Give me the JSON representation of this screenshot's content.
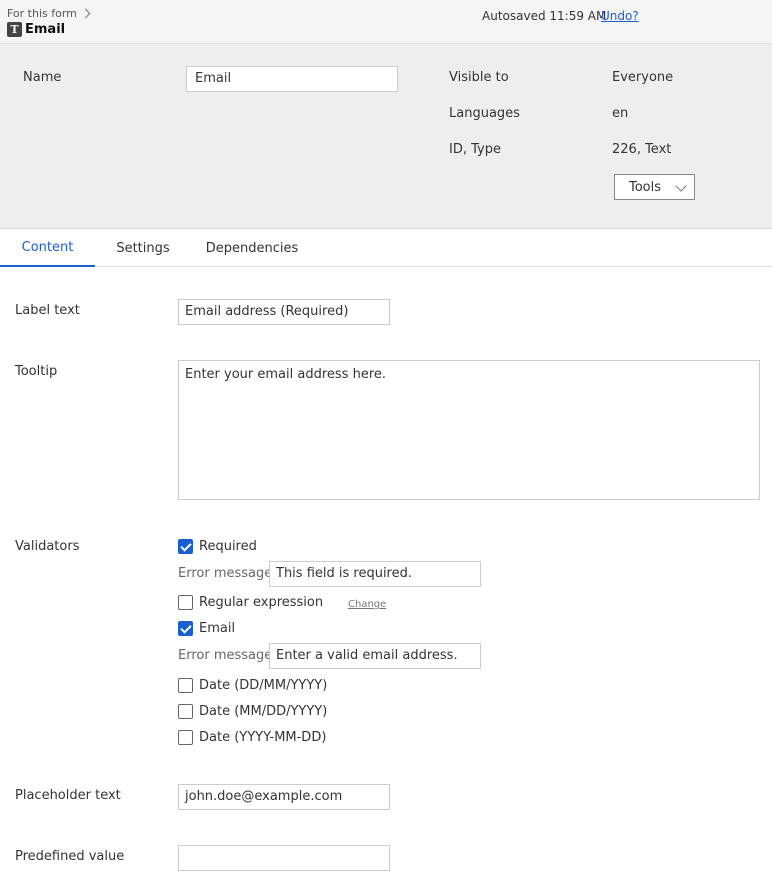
{
  "header": {
    "breadcrumb": "For this form",
    "type_icon_letter": "T",
    "title": "Email",
    "autosave": "Autosaved 11:59 AM",
    "undo_label": "Undo?"
  },
  "properties": {
    "name_label": "Name",
    "name_value": "Email",
    "visible_to_label": "Visible to",
    "visible_to_value": "Everyone",
    "languages_label": "Languages",
    "languages_value": "en",
    "id_type_label": "ID, Type",
    "id_type_value": "226, Text",
    "tools_label": "Tools"
  },
  "tabs": [
    {
      "label": "Content",
      "active": true
    },
    {
      "label": "Settings",
      "active": false
    },
    {
      "label": "Dependencies",
      "active": false
    }
  ],
  "form": {
    "label_text_label": "Label text",
    "label_text_value": "Email address (Required)",
    "tooltip_label": "Tooltip",
    "tooltip_value": "Enter your email address here.",
    "validators_label": "Validators",
    "validators": {
      "required_label": "Required",
      "required_checked": true,
      "error_message_label": "Error message",
      "required_error": "This field is required.",
      "regex_label": "Regular expression",
      "regex_checked": false,
      "change_label": "Change",
      "email_label": "Email",
      "email_checked": true,
      "email_error": "Enter a valid email address.",
      "date_dmy_label": "Date (DD/MM/YYYY)",
      "date_mdy_label": "Date (MM/DD/YYYY)",
      "date_ymd_label": "Date (YYYY-MM-DD)"
    },
    "placeholder_label": "Placeholder text",
    "placeholder_value": "john.doe@example.com",
    "predefined_label": "Predefined value",
    "predefined_value": ""
  },
  "colors": {
    "accent": "#1a5fcf",
    "header_bg": "#eeeeef",
    "topbar_bg": "#f5f5f5"
  },
  "icons": [
    "chevron-right-icon",
    "text-type-icon",
    "chevron-down-icon",
    "checkbox-checked-icon",
    "checkbox-unchecked-icon"
  ]
}
